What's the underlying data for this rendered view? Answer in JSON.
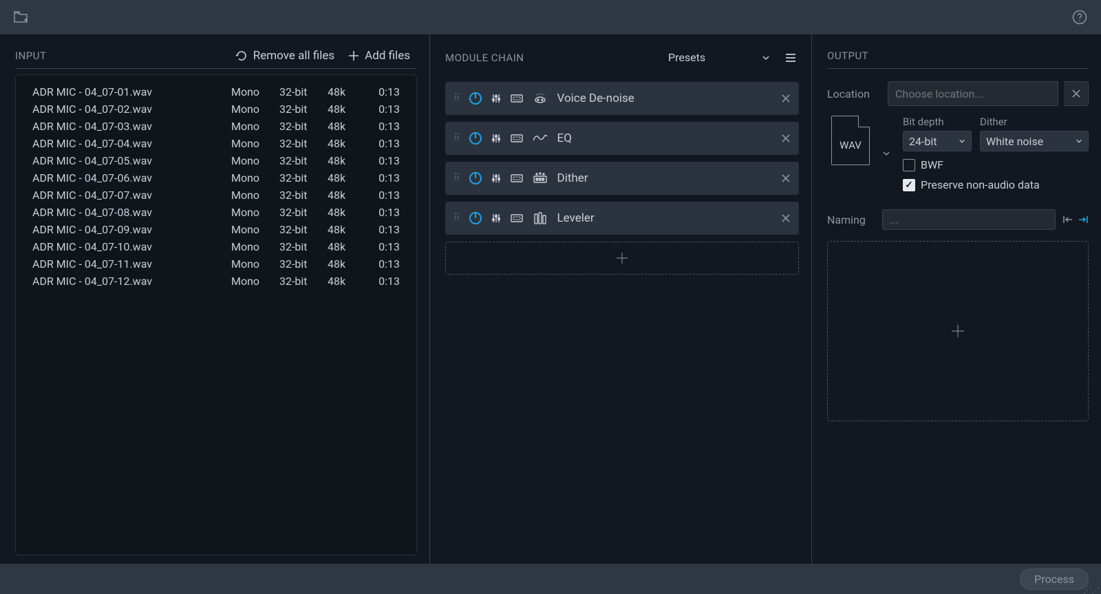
{
  "topbar": {},
  "input": {
    "title": "INPUT",
    "remove_all": "Remove all files",
    "add_files": "Add files",
    "files": [
      {
        "name": "ADR MIC - 04_07-01.wav",
        "ch": "Mono",
        "bit": "32-bit",
        "rate": "48k",
        "dur": "0:13"
      },
      {
        "name": "ADR MIC - 04_07-02.wav",
        "ch": "Mono",
        "bit": "32-bit",
        "rate": "48k",
        "dur": "0:13"
      },
      {
        "name": "ADR MIC - 04_07-03.wav",
        "ch": "Mono",
        "bit": "32-bit",
        "rate": "48k",
        "dur": "0:13"
      },
      {
        "name": "ADR MIC - 04_07-04.wav",
        "ch": "Mono",
        "bit": "32-bit",
        "rate": "48k",
        "dur": "0:13"
      },
      {
        "name": "ADR MIC - 04_07-05.wav",
        "ch": "Mono",
        "bit": "32-bit",
        "rate": "48k",
        "dur": "0:13"
      },
      {
        "name": "ADR MIC - 04_07-06.wav",
        "ch": "Mono",
        "bit": "32-bit",
        "rate": "48k",
        "dur": "0:13"
      },
      {
        "name": "ADR MIC - 04_07-07.wav",
        "ch": "Mono",
        "bit": "32-bit",
        "rate": "48k",
        "dur": "0:13"
      },
      {
        "name": "ADR MIC - 04_07-08.wav",
        "ch": "Mono",
        "bit": "32-bit",
        "rate": "48k",
        "dur": "0:13"
      },
      {
        "name": "ADR MIC - 04_07-09.wav",
        "ch": "Mono",
        "bit": "32-bit",
        "rate": "48k",
        "dur": "0:13"
      },
      {
        "name": "ADR MIC - 04_07-10.wav",
        "ch": "Mono",
        "bit": "32-bit",
        "rate": "48k",
        "dur": "0:13"
      },
      {
        "name": "ADR MIC - 04_07-11.wav",
        "ch": "Mono",
        "bit": "32-bit",
        "rate": "48k",
        "dur": "0:13"
      },
      {
        "name": "ADR MIC - 04_07-12.wav",
        "ch": "Mono",
        "bit": "32-bit",
        "rate": "48k",
        "dur": "0:13"
      }
    ]
  },
  "chain": {
    "title": "MODULE CHAIN",
    "presets_label": "Presets",
    "modules": [
      {
        "name": "Voice De-noise",
        "icon": "voice"
      },
      {
        "name": "EQ",
        "icon": "eq"
      },
      {
        "name": "Dither",
        "icon": "dither"
      },
      {
        "name": "Leveler",
        "icon": "leveler"
      }
    ]
  },
  "output": {
    "title": "OUTPUT",
    "location_label": "Location",
    "location_placeholder": "Choose location...",
    "format": "WAV",
    "bit_depth_label": "Bit depth",
    "bit_depth_value": "24-bit",
    "dither_label": "Dither",
    "dither_value": "White noise",
    "bwf_label": "BWF",
    "bwf_checked": false,
    "preserve_label": "Preserve non-audio data",
    "preserve_checked": true,
    "naming_label": "Naming",
    "naming_placeholder": "..."
  },
  "footer": {
    "process": "Process"
  }
}
